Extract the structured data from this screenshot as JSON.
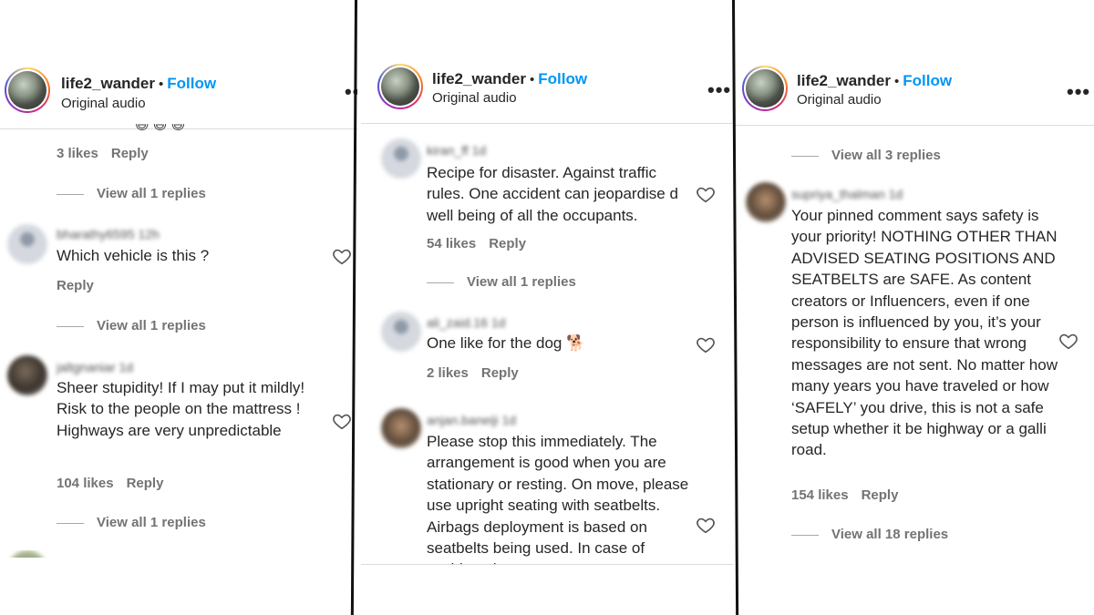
{
  "header": {
    "username": "life2_wander",
    "separator": "•",
    "follow_label": "Follow",
    "subtitle": "Original audio",
    "more_label": "•••"
  },
  "panel1": {
    "partial_emojis": "😄 😄 😄",
    "c0": {
      "likes": "3 likes",
      "reply": "Reply",
      "view_replies": "View all 1 replies"
    },
    "c1": {
      "name": "bharathy6595",
      "time": "12h",
      "text": "Which vehicle is this ?",
      "reply": "Reply",
      "view_replies": "View all 1 replies"
    },
    "c2": {
      "name": "jaltgnaniar",
      "time": "1d",
      "text": "Sheer stupidity! If I may put it mildly! Risk to the people on the mattress ! Highways are very unpredictable",
      "likes": "104 likes",
      "reply": "Reply",
      "view_replies": "View all 1 replies"
    }
  },
  "panel2": {
    "c1": {
      "name": "kiran_ff",
      "time": "1d",
      "text": "Recipe for disaster. Against traffic rules. One accident can jeopardise d well being of all the occupants.",
      "likes": "54 likes",
      "reply": "Reply",
      "view_replies": "View all 1 replies"
    },
    "c2": {
      "name": "ali_zaid.16",
      "time": "1d",
      "text": "One like for the dog 🐕",
      "likes": "2 likes",
      "reply": "Reply"
    },
    "c3": {
      "name": "anjan.baneiji",
      "time": "1d",
      "text": "Please stop this immediately. The arrangement is good when you are stationary or resting. On move, please use upright seating with seatbelts. Airbags deployment is based on seatbelts being used. In case of accident the"
    }
  },
  "panel3": {
    "top_view_replies": "View all 3 replies",
    "c1": {
      "name": "supriya_thalman",
      "time": "1d",
      "text": "Your pinned comment says safety is your priority! NOTHING OTHER THAN ADVISED SEATING POSITIONS AND SEATBELTS are SAFE. As content creators or Influencers, even if one person is influenced by you, it’s your responsibility to ensure that wrong messages are not sent. No matter how many years you have traveled or how ‘SAFELY’ you drive, this is not a safe setup whether it be highway or a galli road.",
      "likes": "154 likes",
      "reply": "Reply",
      "view_replies": "View all 18 replies"
    }
  },
  "colors": {
    "follow": "#0095f6",
    "meta": "#737373",
    "text": "#262626",
    "divider": "#dbdbdb"
  },
  "icons": {
    "heart": "heart-icon",
    "more": "more-options-icon"
  }
}
